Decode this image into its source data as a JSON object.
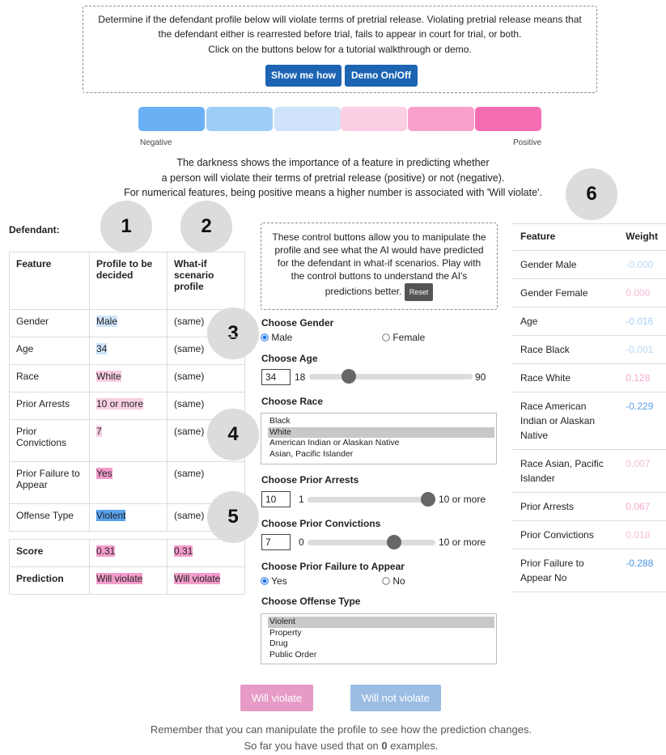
{
  "intro": {
    "line1": "Determine if the defendant profile below will violate terms of pretrial release. Violating pretrial release means that",
    "line2": "the defendant either is rearrested before trial, fails to appear in court for trial, or both.",
    "line3": "Click on the buttons below for a tutorial walkthrough or demo.",
    "show_me_how": "Show me how",
    "demo_toggle": "Demo On/Off"
  },
  "legend": {
    "negative": "Negative",
    "positive": "Positive",
    "colors": [
      "#6ab0f4",
      "#9ecdf8",
      "#cfe4fb",
      "#fbcfe3",
      "#f9a1cd",
      "#f56eb3"
    ],
    "explanation_1": "The darkness shows the importance of a feature in predicting whether",
    "explanation_2": "a person will violate their terms of pretrial release (positive) or not (negative).",
    "explanation_3": "For numerical features, being positive means a higher number is associated with 'Will violate'."
  },
  "callouts": [
    "1",
    "2",
    "3",
    "4",
    "5",
    "6"
  ],
  "defendant": {
    "title": "Defendant:",
    "headers": [
      "Feature",
      "Profile to be decided",
      "What-if scenario profile"
    ],
    "rows": [
      {
        "feature": "Gender",
        "profile": "Male",
        "whatif": "(same)"
      },
      {
        "feature": "Age",
        "profile": "34",
        "whatif": "(same)"
      },
      {
        "feature": "Race",
        "profile": "White",
        "whatif": "(same)"
      },
      {
        "feature": "Prior Arrests",
        "profile": "10 or more",
        "whatif": "(same)"
      },
      {
        "feature": "Prior Convictions",
        "profile": "7",
        "whatif": "(same)"
      },
      {
        "feature": "Prior Failure to Appear",
        "profile": "Yes",
        "whatif": "(same)"
      },
      {
        "feature": "Offense Type",
        "profile": "Violent",
        "whatif": "(same)"
      }
    ],
    "score_label": "Score",
    "score_profile": "0.31",
    "score_whatif": "0.31",
    "prediction_label": "Prediction",
    "prediction_profile": "Will violate",
    "prediction_whatif": "Will violate"
  },
  "controls": {
    "help_line1": "These control buttons allow you to manipulate the",
    "help_line2": "profile and see what the AI would have predicted",
    "help_line3": "for the defendant in what-if scenarios. Play with",
    "help_line4": "the control buttons to understand the AI's",
    "help_line5": "predictions better.",
    "reset": "Reset",
    "gender_label": "Choose Gender",
    "gender_options": [
      "Male",
      "Female"
    ],
    "gender_selected": "Male",
    "age_label": "Choose Age",
    "age_value": "34",
    "age_min": "18",
    "age_max": "90",
    "age_level": 0.22,
    "race_label": "Choose Race",
    "race_options": [
      "Black",
      "White",
      "American Indian or Alaskan Native",
      "Asian, Pacific Islander"
    ],
    "race_selected": "White",
    "arrests_label": "Choose Prior Arrests",
    "arrests_value": "10",
    "arrests_min": "1",
    "arrests_max": "10 or more",
    "arrests_level": 1.0,
    "convictions_label": "Choose Prior Convictions",
    "convictions_value": "7",
    "convictions_min": "0",
    "convictions_max": "10 or more",
    "convictions_level": 0.7,
    "fta_label": "Choose Prior Failure to Appear",
    "fta_options": [
      "Yes",
      "No"
    ],
    "fta_selected": "Yes",
    "offense_label": "Choose Offense Type",
    "offense_options": [
      "Violent",
      "Property",
      "Drug",
      "Public Order"
    ],
    "offense_selected": "Violent"
  },
  "weights": {
    "headers": [
      "Feature",
      "Weight"
    ],
    "rows": [
      {
        "feature": "Gender Male",
        "weight": "-0.000",
        "color": "#b9d8f6"
      },
      {
        "feature": "Gender Female",
        "weight": "0.000",
        "color": "#f7bcd8"
      },
      {
        "feature": "Age",
        "weight": "-0.016",
        "color": "#a9cff4"
      },
      {
        "feature": "Race Black",
        "weight": "-0.001",
        "color": "#b9d8f6"
      },
      {
        "feature": "Race White",
        "weight": "0.128",
        "color": "#f6a9ce"
      },
      {
        "feature": "Race American Indian or Alaskan Native",
        "weight": "-0.229",
        "color": "#5a9fe6"
      },
      {
        "feature": "Race Asian, Pacific Islander",
        "weight": "0.007",
        "color": "#f7bcd8"
      },
      {
        "feature": "Prior Arrests",
        "weight": "0.067",
        "color": "#f6a9ce"
      },
      {
        "feature": "Prior Convictions",
        "weight": "0.018",
        "color": "#f7bcd8"
      },
      {
        "feature": "Prior Failure to Appear No",
        "weight": "-0.288",
        "color": "#4a93e0"
      }
    ]
  },
  "decision": {
    "will_violate": "Will violate",
    "will_not_violate": "Will not violate",
    "reminder": "Remember that you can manipulate the profile to see how the prediction changes.",
    "count_prefix": "So far you have used that on ",
    "count": "0",
    "count_suffix": " examples."
  }
}
